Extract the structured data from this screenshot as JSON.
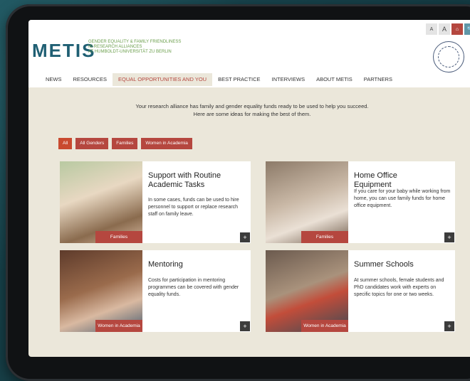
{
  "site": {
    "logo": "METIS",
    "tagline": [
      "GENDER EQUALITY & FAMILY FRIENDLINESS",
      "IN RESEARCH ALLIANCES",
      "AT HUMBOLDT-UNIVERSITÄT ZU BERLIN"
    ],
    "tools": {
      "font_smaller": "A",
      "font_larger": "A",
      "home": "⌂",
      "search": "🔍"
    }
  },
  "nav": [
    {
      "label": "NEWS",
      "active": false
    },
    {
      "label": "RESOURCES",
      "active": false
    },
    {
      "label": "EQUAL OPPORTUNITIES AND YOU",
      "active": true
    },
    {
      "label": "BEST PRACTICE",
      "active": false
    },
    {
      "label": "INTERVIEWS",
      "active": false
    },
    {
      "label": "ABOUT METIS",
      "active": false
    },
    {
      "label": "PARTNERS",
      "active": false
    }
  ],
  "intro": {
    "line1": "Your research alliance has family and gender equality funds ready to be used to help you succeed.",
    "line2": "Here are some ideas for making the best of them."
  },
  "filters": [
    "All",
    "All Genders",
    "Families",
    "Women in Academia"
  ],
  "cards": [
    {
      "title": "Support with Routine Academic Tasks",
      "text": "In some cases, funds can be used to hire personnel to support or replace research staff on family leave.",
      "tag": "Families",
      "plus": "+"
    },
    {
      "title": "Home Office Equipment",
      "text": "If you care for your baby while working from home, you can use family funds for home office equipment.",
      "tag": "Families",
      "plus": "+"
    },
    {
      "title": "Mentoring",
      "text": "Costs for participation in mentoring programmes can be covered with gender equality funds.",
      "tag": "Women in Academia",
      "plus": "+"
    },
    {
      "title": "Summer Schools",
      "text": "At summer schools, female students and PhD candidates work with experts on specific topics for one or two weeks.",
      "tag": "Women in Academia",
      "plus": "+"
    }
  ],
  "colors": {
    "accent": "#b5473f",
    "brand": "#1f5f73",
    "background": "#ebe7da"
  }
}
